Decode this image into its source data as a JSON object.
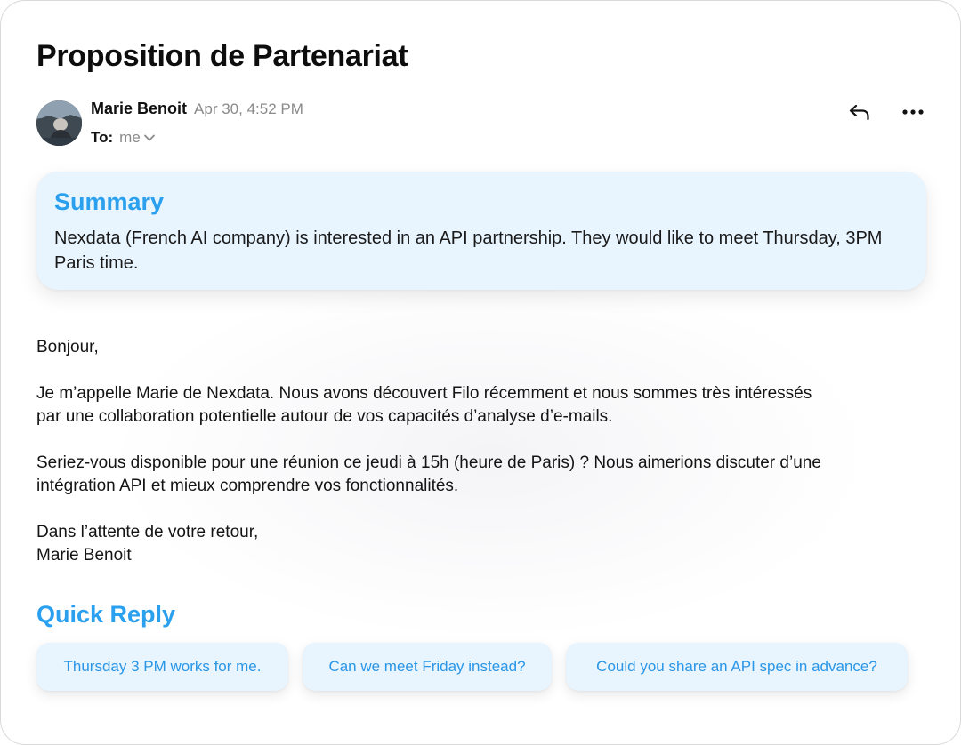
{
  "email": {
    "subject": "Proposition de Partenariat",
    "sender_name": "Marie Benoit",
    "sent_time": "Apr 30, 4:52 PM",
    "to_label": "To:",
    "to_value": "me",
    "icons": {
      "avatar": "sender-avatar-photo",
      "reply": "reply-arrow-icon",
      "more": "more-horizontal-icon",
      "to_dropdown": "chevron-down-icon"
    }
  },
  "summary": {
    "title": "Summary",
    "text": "Nexdata (French AI company) is interested in an API partnership. They would like to meet Thursday, 3PM Paris time."
  },
  "body": {
    "greeting": "Bonjour,",
    "paragraph1_lines": [
      "Je m’appelle Marie de Nexdata. Nous avons découvert Filo récemment et nous sommes très intéressés",
      "par une collaboration potentielle autour de vos capacités d’analyse d’e-mails."
    ],
    "paragraph2_lines": [
      "Seriez-vous disponible pour une réunion ce jeudi à 15h (heure de Paris) ? Nous aimerions discuter d’une",
      "intégration API et mieux comprendre vos fonctionnalités."
    ],
    "closing": "Dans l’attente de votre retour,",
    "signature": "Marie Benoit"
  },
  "quick_reply": {
    "title": "Quick Reply",
    "options": [
      "Thursday 3 PM works for me.",
      "Can we meet Friday instead?",
      "Could you share an API spec in advance?"
    ]
  },
  "colors": {
    "accent": "#2aa0ee",
    "card_background": "#e8f4fe",
    "muted_text": "#8a8a8a",
    "primary_text": "#111111"
  }
}
